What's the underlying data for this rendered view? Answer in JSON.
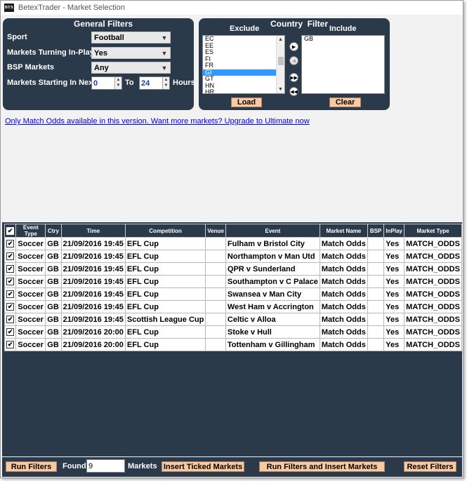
{
  "window": {
    "app_icon_text": "BTX",
    "title": "BetexTrader - Market Selection"
  },
  "general_filters": {
    "title": "General Filters",
    "sport_label": "Sport",
    "sport_value": "Football",
    "inplay_label": "Markets Turning In-Play",
    "inplay_value": "Yes",
    "bsp_label": "BSP Markets",
    "bsp_value": "Any",
    "starting_label": "Markets Starting In Next",
    "from_value": "0",
    "to_label": "To",
    "to_value": "24",
    "hours_label": "Hours"
  },
  "country_filter": {
    "title": "Country  Filter",
    "exclude_label": "Exclude",
    "include_label": "Include",
    "exclude_items": [
      "EC",
      "EE",
      "ES",
      "FI",
      "FR",
      "GI",
      "GT",
      "HN",
      "HR"
    ],
    "selected_exclude": "GI",
    "include_items": [
      "GB"
    ],
    "load_label": "Load",
    "clear_label": "Clear"
  },
  "upgrade_link": "Only Match Odds available in this version. Want more markets? Upgrade to Ultimate now",
  "grid": {
    "columns": [
      "",
      "Event Type",
      "Ctry",
      "Time",
      "Competition",
      "Venue",
      "Event",
      "Market Name",
      "BSP",
      "InPlay",
      "Market Type"
    ],
    "rows": [
      {
        "type": "Soccer",
        "ctry": "GB",
        "time": "21/09/2016 19:45",
        "comp": "EFL Cup",
        "venue": "",
        "event": "Fulham v Bristol City",
        "market": "Match Odds",
        "bsp": "",
        "inplay": "Yes",
        "mtype": "MATCH_ODDS"
      },
      {
        "type": "Soccer",
        "ctry": "GB",
        "time": "21/09/2016 19:45",
        "comp": "EFL Cup",
        "venue": "",
        "event": "Northampton v Man Utd",
        "market": "Match Odds",
        "bsp": "",
        "inplay": "Yes",
        "mtype": "MATCH_ODDS"
      },
      {
        "type": "Soccer",
        "ctry": "GB",
        "time": "21/09/2016 19:45",
        "comp": "EFL Cup",
        "venue": "",
        "event": "QPR v Sunderland",
        "market": "Match Odds",
        "bsp": "",
        "inplay": "Yes",
        "mtype": "MATCH_ODDS"
      },
      {
        "type": "Soccer",
        "ctry": "GB",
        "time": "21/09/2016 19:45",
        "comp": "EFL Cup",
        "venue": "",
        "event": "Southampton v C Palace",
        "market": "Match Odds",
        "bsp": "",
        "inplay": "Yes",
        "mtype": "MATCH_ODDS"
      },
      {
        "type": "Soccer",
        "ctry": "GB",
        "time": "21/09/2016 19:45",
        "comp": "EFL Cup",
        "venue": "",
        "event": "Swansea v Man City",
        "market": "Match Odds",
        "bsp": "",
        "inplay": "Yes",
        "mtype": "MATCH_ODDS"
      },
      {
        "type": "Soccer",
        "ctry": "GB",
        "time": "21/09/2016 19:45",
        "comp": "EFL Cup",
        "venue": "",
        "event": "West Ham v Accrington",
        "market": "Match Odds",
        "bsp": "",
        "inplay": "Yes",
        "mtype": "MATCH_ODDS"
      },
      {
        "type": "Soccer",
        "ctry": "GB",
        "time": "21/09/2016 19:45",
        "comp": "Scottish League Cup",
        "venue": "",
        "event": "Celtic v Alloa",
        "market": "Match Odds",
        "bsp": "",
        "inplay": "Yes",
        "mtype": "MATCH_ODDS"
      },
      {
        "type": "Soccer",
        "ctry": "GB",
        "time": "21/09/2016 20:00",
        "comp": "EFL Cup",
        "venue": "",
        "event": "Stoke v Hull",
        "market": "Match Odds",
        "bsp": "",
        "inplay": "Yes",
        "mtype": "MATCH_ODDS"
      },
      {
        "type": "Soccer",
        "ctry": "GB",
        "time": "21/09/2016 20:00",
        "comp": "EFL Cup",
        "venue": "",
        "event": "Tottenham v Gillingham",
        "market": "Match Odds",
        "bsp": "",
        "inplay": "Yes",
        "mtype": "MATCH_ODDS"
      }
    ]
  },
  "bottom": {
    "run_filters_label": "Run Filters",
    "found_label": "Found",
    "found_value": "9",
    "markets_label": "Markets",
    "insert_ticked_label": "Insert Ticked Markets",
    "run_insert_label": "Run Filters and Insert Markets",
    "reset_label": "Reset Filters"
  },
  "colors": {
    "panel": "#2b3a4a",
    "button": "#f9c9a0",
    "selection": "#3399ff",
    "link": "#0000ee"
  }
}
